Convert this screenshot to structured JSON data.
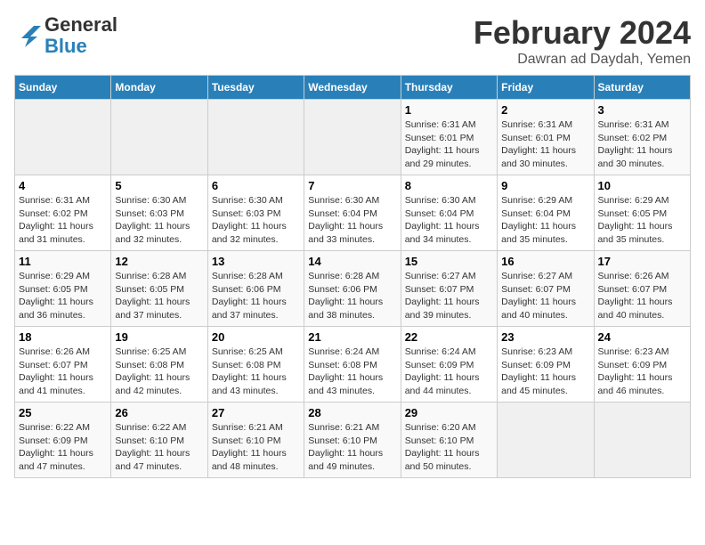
{
  "logo": {
    "general": "General",
    "blue": "Blue"
  },
  "header": {
    "month": "February 2024",
    "location": "Dawran ad Daydah, Yemen"
  },
  "weekdays": [
    "Sunday",
    "Monday",
    "Tuesday",
    "Wednesday",
    "Thursday",
    "Friday",
    "Saturday"
  ],
  "weeks": [
    [
      {
        "day": "",
        "sunrise": "",
        "sunset": "",
        "daylight": ""
      },
      {
        "day": "",
        "sunrise": "",
        "sunset": "",
        "daylight": ""
      },
      {
        "day": "",
        "sunrise": "",
        "sunset": "",
        "daylight": ""
      },
      {
        "day": "",
        "sunrise": "",
        "sunset": "",
        "daylight": ""
      },
      {
        "day": "1",
        "sunrise": "Sunrise: 6:31 AM",
        "sunset": "Sunset: 6:01 PM",
        "daylight": "Daylight: 11 hours and 29 minutes."
      },
      {
        "day": "2",
        "sunrise": "Sunrise: 6:31 AM",
        "sunset": "Sunset: 6:01 PM",
        "daylight": "Daylight: 11 hours and 30 minutes."
      },
      {
        "day": "3",
        "sunrise": "Sunrise: 6:31 AM",
        "sunset": "Sunset: 6:02 PM",
        "daylight": "Daylight: 11 hours and 30 minutes."
      }
    ],
    [
      {
        "day": "4",
        "sunrise": "Sunrise: 6:31 AM",
        "sunset": "Sunset: 6:02 PM",
        "daylight": "Daylight: 11 hours and 31 minutes."
      },
      {
        "day": "5",
        "sunrise": "Sunrise: 6:30 AM",
        "sunset": "Sunset: 6:03 PM",
        "daylight": "Daylight: 11 hours and 32 minutes."
      },
      {
        "day": "6",
        "sunrise": "Sunrise: 6:30 AM",
        "sunset": "Sunset: 6:03 PM",
        "daylight": "Daylight: 11 hours and 32 minutes."
      },
      {
        "day": "7",
        "sunrise": "Sunrise: 6:30 AM",
        "sunset": "Sunset: 6:04 PM",
        "daylight": "Daylight: 11 hours and 33 minutes."
      },
      {
        "day": "8",
        "sunrise": "Sunrise: 6:30 AM",
        "sunset": "Sunset: 6:04 PM",
        "daylight": "Daylight: 11 hours and 34 minutes."
      },
      {
        "day": "9",
        "sunrise": "Sunrise: 6:29 AM",
        "sunset": "Sunset: 6:04 PM",
        "daylight": "Daylight: 11 hours and 35 minutes."
      },
      {
        "day": "10",
        "sunrise": "Sunrise: 6:29 AM",
        "sunset": "Sunset: 6:05 PM",
        "daylight": "Daylight: 11 hours and 35 minutes."
      }
    ],
    [
      {
        "day": "11",
        "sunrise": "Sunrise: 6:29 AM",
        "sunset": "Sunset: 6:05 PM",
        "daylight": "Daylight: 11 hours and 36 minutes."
      },
      {
        "day": "12",
        "sunrise": "Sunrise: 6:28 AM",
        "sunset": "Sunset: 6:05 PM",
        "daylight": "Daylight: 11 hours and 37 minutes."
      },
      {
        "day": "13",
        "sunrise": "Sunrise: 6:28 AM",
        "sunset": "Sunset: 6:06 PM",
        "daylight": "Daylight: 11 hours and 37 minutes."
      },
      {
        "day": "14",
        "sunrise": "Sunrise: 6:28 AM",
        "sunset": "Sunset: 6:06 PM",
        "daylight": "Daylight: 11 hours and 38 minutes."
      },
      {
        "day": "15",
        "sunrise": "Sunrise: 6:27 AM",
        "sunset": "Sunset: 6:07 PM",
        "daylight": "Daylight: 11 hours and 39 minutes."
      },
      {
        "day": "16",
        "sunrise": "Sunrise: 6:27 AM",
        "sunset": "Sunset: 6:07 PM",
        "daylight": "Daylight: 11 hours and 40 minutes."
      },
      {
        "day": "17",
        "sunrise": "Sunrise: 6:26 AM",
        "sunset": "Sunset: 6:07 PM",
        "daylight": "Daylight: 11 hours and 40 minutes."
      }
    ],
    [
      {
        "day": "18",
        "sunrise": "Sunrise: 6:26 AM",
        "sunset": "Sunset: 6:07 PM",
        "daylight": "Daylight: 11 hours and 41 minutes."
      },
      {
        "day": "19",
        "sunrise": "Sunrise: 6:25 AM",
        "sunset": "Sunset: 6:08 PM",
        "daylight": "Daylight: 11 hours and 42 minutes."
      },
      {
        "day": "20",
        "sunrise": "Sunrise: 6:25 AM",
        "sunset": "Sunset: 6:08 PM",
        "daylight": "Daylight: 11 hours and 43 minutes."
      },
      {
        "day": "21",
        "sunrise": "Sunrise: 6:24 AM",
        "sunset": "Sunset: 6:08 PM",
        "daylight": "Daylight: 11 hours and 43 minutes."
      },
      {
        "day": "22",
        "sunrise": "Sunrise: 6:24 AM",
        "sunset": "Sunset: 6:09 PM",
        "daylight": "Daylight: 11 hours and 44 minutes."
      },
      {
        "day": "23",
        "sunrise": "Sunrise: 6:23 AM",
        "sunset": "Sunset: 6:09 PM",
        "daylight": "Daylight: 11 hours and 45 minutes."
      },
      {
        "day": "24",
        "sunrise": "Sunrise: 6:23 AM",
        "sunset": "Sunset: 6:09 PM",
        "daylight": "Daylight: 11 hours and 46 minutes."
      }
    ],
    [
      {
        "day": "25",
        "sunrise": "Sunrise: 6:22 AM",
        "sunset": "Sunset: 6:09 PM",
        "daylight": "Daylight: 11 hours and 47 minutes."
      },
      {
        "day": "26",
        "sunrise": "Sunrise: 6:22 AM",
        "sunset": "Sunset: 6:10 PM",
        "daylight": "Daylight: 11 hours and 47 minutes."
      },
      {
        "day": "27",
        "sunrise": "Sunrise: 6:21 AM",
        "sunset": "Sunset: 6:10 PM",
        "daylight": "Daylight: 11 hours and 48 minutes."
      },
      {
        "day": "28",
        "sunrise": "Sunrise: 6:21 AM",
        "sunset": "Sunset: 6:10 PM",
        "daylight": "Daylight: 11 hours and 49 minutes."
      },
      {
        "day": "29",
        "sunrise": "Sunrise: 6:20 AM",
        "sunset": "Sunset: 6:10 PM",
        "daylight": "Daylight: 11 hours and 50 minutes."
      },
      {
        "day": "",
        "sunrise": "",
        "sunset": "",
        "daylight": ""
      },
      {
        "day": "",
        "sunrise": "",
        "sunset": "",
        "daylight": ""
      }
    ]
  ]
}
